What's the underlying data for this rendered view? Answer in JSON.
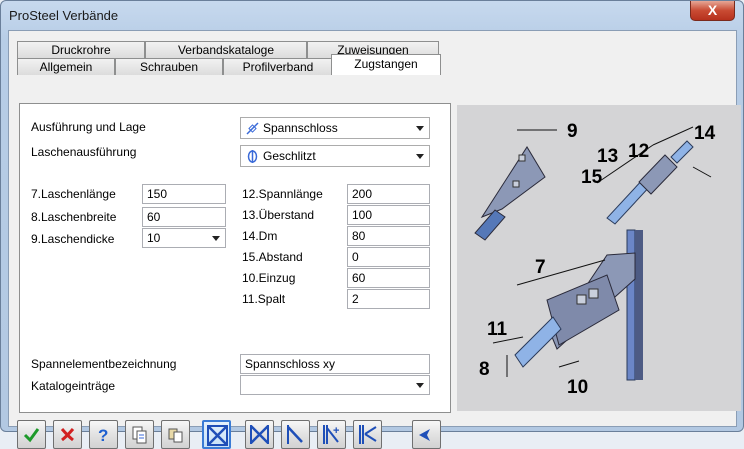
{
  "window": {
    "title": "ProSteel Verbände",
    "close_label": "X"
  },
  "tabs": {
    "row_back": [
      "Druckrohre",
      "Verbandskataloge",
      "Zuweisungen"
    ],
    "row_front": [
      "Allgemein",
      "Schrauben",
      "Profilverband",
      "Zugstangen"
    ],
    "active": "Zugstangen"
  },
  "form": {
    "ausfuehrung_label": "Ausführung und Lage",
    "laschen_label": "Laschenausführung",
    "ausfuehrung_value": "Spannschloss",
    "laschen_value": "Geschlitzt",
    "left_params": [
      {
        "label": "7.Laschenlänge",
        "value": "150"
      },
      {
        "label": "8.Laschenbreite",
        "value": "60"
      },
      {
        "label": "9.Laschendicke",
        "value": "10"
      }
    ],
    "right_params": [
      {
        "label": "12.Spannlänge",
        "value": "200"
      },
      {
        "label": "13.Überstand",
        "value": "100"
      },
      {
        "label": "14.Dm",
        "value": "80"
      },
      {
        "label": "15.Abstand",
        "value": "0"
      },
      {
        "label": "10.Einzug",
        "value": "60"
      },
      {
        "label": "11.Spalt",
        "value": "2"
      }
    ],
    "spann_label": "Spannelementbezeichnung",
    "spann_value": "Spannschloss xy",
    "katalog_label": "Katalogeinträge",
    "katalog_value": ""
  },
  "diagram_labels": [
    "9",
    "13",
    "12",
    "14",
    "15",
    "7",
    "11",
    "8",
    "10"
  ],
  "toolbar": [
    "ok-check",
    "cancel-x",
    "help",
    "copy-file",
    "clipboard",
    "brace-cross-pressed",
    "brace-cross",
    "brace-single",
    "brace-add",
    "brace-remove",
    "arrow-left"
  ],
  "colors": {
    "accent": "#1f3fdf",
    "diagram_bg": "#d4d4d6",
    "steel": "#8c98b6"
  }
}
